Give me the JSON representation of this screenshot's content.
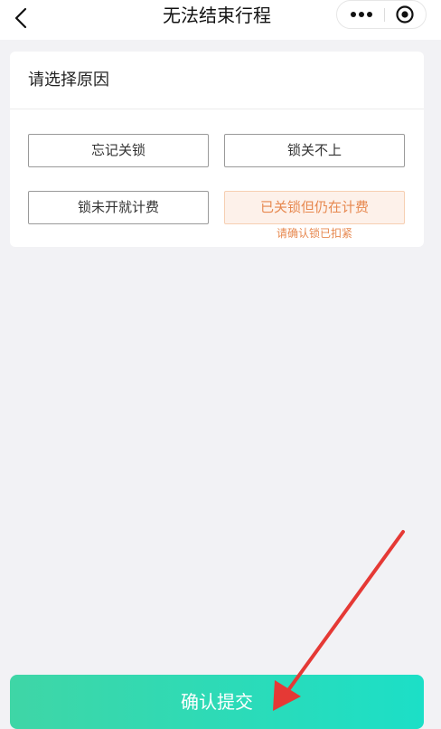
{
  "navbar": {
    "title": "无法结束行程",
    "back_icon": "chevron-left-icon",
    "more_icon": "more-dots-icon",
    "close_icon": "target-close-icon"
  },
  "card": {
    "title": "请选择原因",
    "reasons": [
      {
        "label": "忘记关锁",
        "selected": false
      },
      {
        "label": "锁关不上",
        "selected": false
      },
      {
        "label": "锁未开就计费",
        "selected": false
      },
      {
        "label": "已关锁但仍在计费",
        "selected": true
      }
    ],
    "hint": "请确认锁已扣紧"
  },
  "footer": {
    "confirm_label": "确认提交"
  },
  "colors": {
    "accent_start": "#3fd6a6",
    "accent_end": "#1cdfc7",
    "selected_text": "#e7884f",
    "selected_bg": "#fdf1ea",
    "annotation_arrow": "#e53935"
  }
}
